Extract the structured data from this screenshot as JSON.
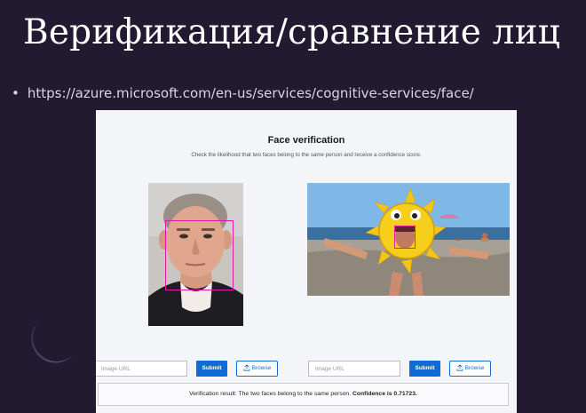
{
  "slide": {
    "title": "Верификация/сравнение лиц",
    "bullet_marker": "•",
    "link": "https://azure.microsoft.com/en-us/services/cognitive-services/face/"
  },
  "app": {
    "title": "Face verification",
    "subtitle": "Check the likelihood that two faces belong to the same person and receive a confidence score.",
    "left_panel": {
      "url_placeholder": "Image URL",
      "submit_label": "Submit",
      "browse_label": "Browse",
      "browse_icon": "upload-icon"
    },
    "right_panel": {
      "url_placeholder": "Image URL",
      "submit_label": "Submit",
      "browse_label": "Browse",
      "browse_icon": "upload-icon"
    },
    "result": {
      "prefix": "Verification result: The two faces belong to the same person.",
      "confidence_label": "Confidence is 0.71723."
    },
    "colors": {
      "face_box": "#e31aa8",
      "accent": "#0f6cd6"
    }
  }
}
